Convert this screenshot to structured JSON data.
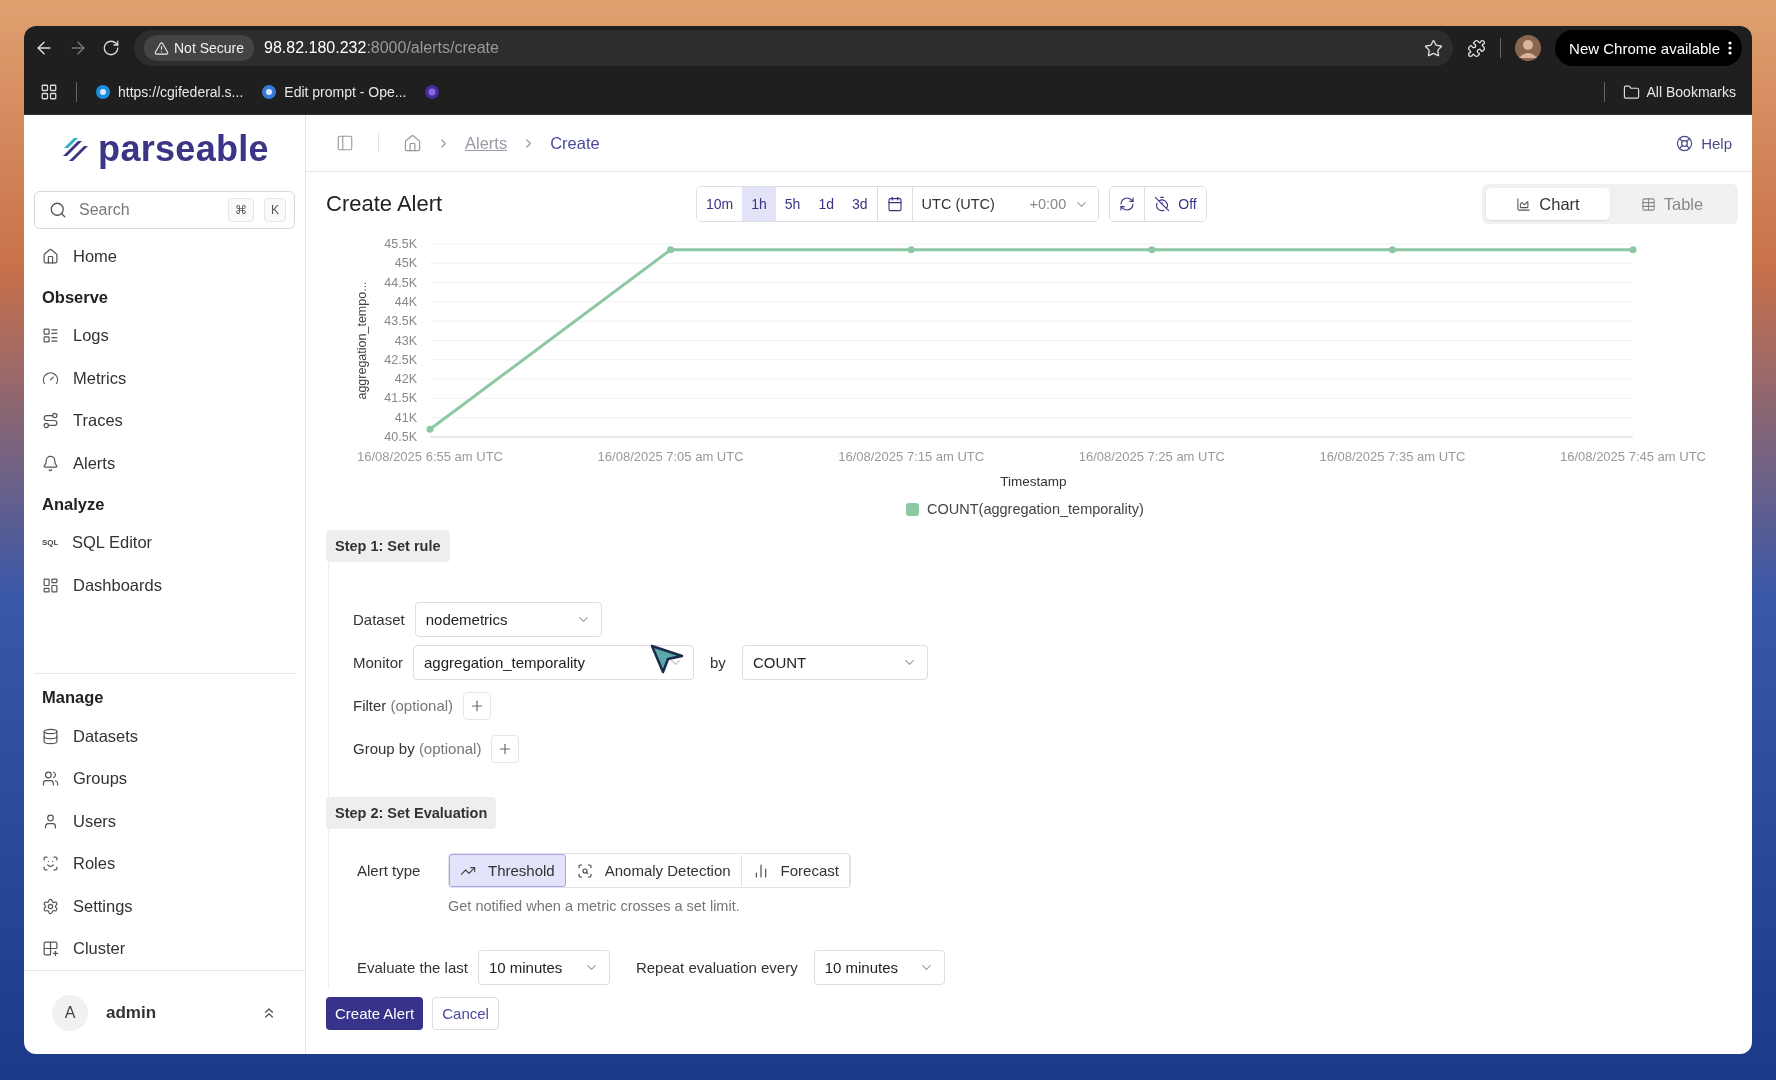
{
  "browser": {
    "security": "Not Secure",
    "url_host": "98.82.180.232",
    "url_path": ":8000/alerts/create",
    "update_button": "New Chrome available",
    "bookmarks": [
      {
        "kind": "link",
        "label": "https://cgifederal.s..."
      },
      {
        "kind": "link",
        "label": "Edit prompt - Ope..."
      },
      {
        "kind": "icon"
      }
    ],
    "all_bookmarks": "All Bookmarks"
  },
  "sidebar": {
    "logo": "parseable",
    "search": {
      "placeholder": "Search",
      "keys": [
        "⌘",
        "K"
      ]
    },
    "home": "Home",
    "sections": [
      {
        "heading": "Observe",
        "items": [
          {
            "label": "Logs"
          },
          {
            "label": "Metrics"
          },
          {
            "label": "Traces"
          },
          {
            "label": "Alerts"
          }
        ]
      },
      {
        "heading": "Analyze",
        "items": [
          {
            "label": "SQL Editor",
            "badge": "SQL"
          },
          {
            "label": "Dashboards"
          }
        ]
      },
      {
        "heading": "Manage",
        "items": [
          {
            "label": "Datasets"
          },
          {
            "label": "Groups"
          },
          {
            "label": "Users"
          },
          {
            "label": "Roles"
          },
          {
            "label": "Settings"
          },
          {
            "label": "Cluster"
          }
        ]
      }
    ],
    "user": {
      "initial": "A",
      "name": "admin"
    }
  },
  "topbar": {
    "breadcrumbs": [
      {
        "label": "Alerts",
        "kind": "link"
      },
      {
        "label": "Create",
        "kind": "current"
      }
    ],
    "help": "Help"
  },
  "header": {
    "title": "Create Alert",
    "time_ranges": [
      {
        "label": "10m",
        "selected": false
      },
      {
        "label": "1h",
        "selected": true
      },
      {
        "label": "5h",
        "selected": false
      },
      {
        "label": "1d",
        "selected": false
      },
      {
        "label": "3d",
        "selected": false
      }
    ],
    "timezone": "UTC (UTC)",
    "offset": "+0:00",
    "refresh": "Off",
    "views": [
      {
        "label": "Chart",
        "selected": true
      },
      {
        "label": "Table",
        "selected": false
      }
    ]
  },
  "chart_data": {
    "type": "line",
    "xlabel": "Timestamp",
    "ylabel": "aggregation_tempo...",
    "categories": [
      "16/08/2025 6:55 am UTC",
      "16/08/2025 7:05 am UTC",
      "16/08/2025 7:15 am UTC",
      "16/08/2025 7:25 am UTC",
      "16/08/2025 7:35 am UTC",
      "16/08/2025 7:45 am UTC"
    ],
    "series": [
      {
        "name": "COUNT(aggregation_temporality)",
        "color": "#8cc8a4",
        "values": [
          40700,
          45350,
          45350,
          45350,
          45350,
          45350
        ]
      }
    ],
    "ylim": [
      40500,
      45500
    ],
    "grid": true,
    "marker": true,
    "yticks": [
      {
        "value": 40500,
        "label": "40.5K"
      },
      {
        "value": 41000,
        "label": "41K"
      },
      {
        "value": 41500,
        "label": "41.5K"
      },
      {
        "value": 42000,
        "label": "42K"
      },
      {
        "value": 42500,
        "label": "42.5K"
      },
      {
        "value": 43000,
        "label": "43K"
      },
      {
        "value": 43500,
        "label": "43.5K"
      },
      {
        "value": 44000,
        "label": "44K"
      },
      {
        "value": 44500,
        "label": "44.5K"
      },
      {
        "value": 45000,
        "label": "45K"
      },
      {
        "value": 45500,
        "label": "45.5K"
      }
    ]
  },
  "step1": {
    "title": "Step 1: Set rule",
    "dataset": {
      "label": "Dataset",
      "value": "nodemetrics"
    },
    "monitor": {
      "label": "Monitor",
      "value": "aggregation_temporality",
      "by_label": "by",
      "aggregate": "COUNT"
    },
    "filter": {
      "label": "Filter",
      "hint": "(optional)"
    },
    "group_by": {
      "label": "Group by",
      "hint": "(optional)"
    }
  },
  "step2": {
    "title": "Step 2: Set Evaluation",
    "alert_type_label": "Alert type",
    "alert_types": [
      {
        "label": "Threshold",
        "selected": true
      },
      {
        "label": "Anomaly Detection",
        "selected": false
      },
      {
        "label": "Forecast",
        "selected": false
      }
    ],
    "description": "Get notified when a metric crosses a set limit.",
    "evaluate": {
      "label": "Evaluate the last",
      "value": "10 minutes"
    },
    "repeat": {
      "label": "Repeat evaluation every",
      "value": "10 minutes"
    }
  },
  "actions": {
    "primary": "Create Alert",
    "secondary": "Cancel"
  }
}
